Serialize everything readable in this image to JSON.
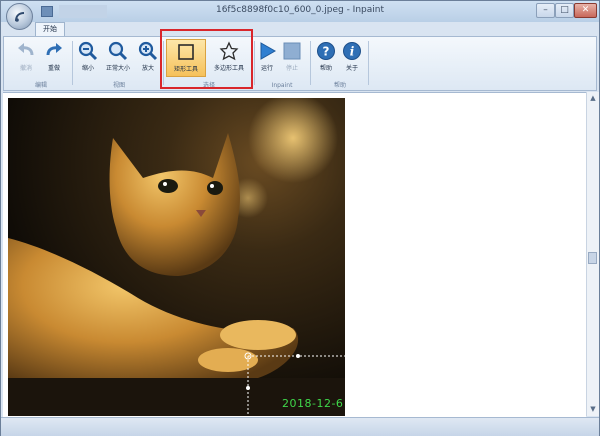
{
  "window": {
    "title": "16f5c8898f0c10_600_0.jpeg - Inpaint",
    "controls": {
      "minimize": "–",
      "maximize": "□",
      "close": "✕"
    }
  },
  "tabs": [
    {
      "label": "开始"
    }
  ],
  "ribbon": {
    "groups": [
      {
        "label": "编辑",
        "buttons": [
          {
            "label": "撤消",
            "icon": "undo-icon",
            "enabled": false
          },
          {
            "label": "重做",
            "icon": "redo-icon",
            "enabled": true
          }
        ]
      },
      {
        "label": "视图",
        "buttons": [
          {
            "label": "缩小",
            "icon": "zoom-out-icon",
            "enabled": true
          },
          {
            "label": "正常大小",
            "icon": "zoom-normal-icon",
            "enabled": true
          },
          {
            "label": "放大",
            "icon": "zoom-in-icon",
            "enabled": true
          }
        ]
      },
      {
        "label": "选择",
        "buttons": [
          {
            "label": "矩形工具",
            "icon": "rectangle-tool-icon",
            "enabled": true,
            "active": true
          },
          {
            "label": "多边形工具",
            "icon": "polygon-tool-icon",
            "enabled": true
          }
        ]
      },
      {
        "label": "Inpaint",
        "buttons": [
          {
            "label": "运行",
            "icon": "run-icon",
            "enabled": true
          },
          {
            "label": "停止",
            "icon": "stop-icon",
            "enabled": false
          }
        ]
      },
      {
        "label": "帮助",
        "buttons": [
          {
            "label": "帮助",
            "icon": "help-icon",
            "enabled": true
          },
          {
            "label": "关于",
            "icon": "about-icon",
            "enabled": true
          }
        ]
      }
    ]
  },
  "image": {
    "date_stamp": "2018-12-6"
  },
  "colors": {
    "highlight": "#d9262b",
    "date_stamp": "#3fd64a",
    "ribbon_blue": "#2f6fb5"
  }
}
